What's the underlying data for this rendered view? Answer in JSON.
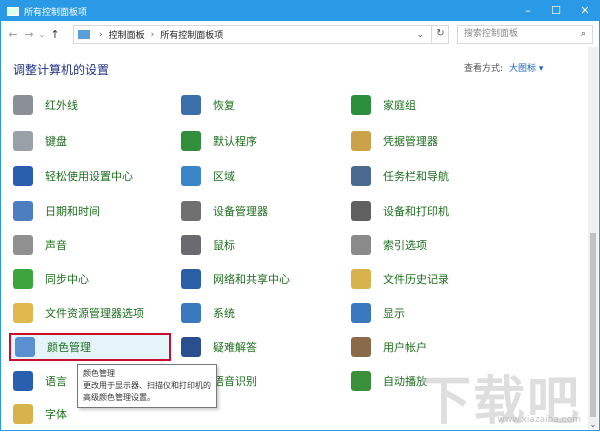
{
  "window": {
    "title": "所有控制面板项",
    "min": "–",
    "max": "☐",
    "close": "✕"
  },
  "address": {
    "back": "←",
    "forward": "→",
    "recent": "⌄",
    "up": "↑",
    "crumbs": [
      "控制面板",
      "所有控制面板项"
    ],
    "sep": "›",
    "dropdown": "⌄",
    "refresh": "↻",
    "search_placeholder": "搜索控制面板",
    "search_icon": "⌕"
  },
  "heading": "调整计算机的设置",
  "view": {
    "label": "查看方式:",
    "value": "大图标 ▾"
  },
  "items": [
    {
      "label": "红外线",
      "icon": "infrared-icon",
      "color": "#8a8f98"
    },
    {
      "label": "恢复",
      "icon": "recovery-icon",
      "color": "#3a6fa8"
    },
    {
      "label": "家庭组",
      "icon": "homegroup-icon",
      "color": "#2c8f3c"
    },
    {
      "label": "键盘",
      "icon": "keyboard-icon",
      "color": "#9aa0a8"
    },
    {
      "label": "默认程序",
      "icon": "default-programs-icon",
      "color": "#2f8f3a"
    },
    {
      "label": "凭据管理器",
      "icon": "credential-manager-icon",
      "color": "#c9a24a"
    },
    {
      "label": "轻松使用设置中心",
      "icon": "ease-of-access-icon",
      "color": "#2a5fb0"
    },
    {
      "label": "区域",
      "icon": "region-icon",
      "color": "#3b86c8"
    },
    {
      "label": "任务栏和导航",
      "icon": "taskbar-icon",
      "color": "#4a6a90"
    },
    {
      "label": "日期和时间",
      "icon": "date-time-icon",
      "color": "#4d7fc0"
    },
    {
      "label": "设备管理器",
      "icon": "device-manager-icon",
      "color": "#707070"
    },
    {
      "label": "设备和打印机",
      "icon": "devices-printers-icon",
      "color": "#606060"
    },
    {
      "label": "声音",
      "icon": "sound-icon",
      "color": "#909090"
    },
    {
      "label": "鼠标",
      "icon": "mouse-icon",
      "color": "#6a6a70"
    },
    {
      "label": "索引选项",
      "icon": "indexing-icon",
      "color": "#8a8a8a"
    },
    {
      "label": "同步中心",
      "icon": "sync-center-icon",
      "color": "#3da53d"
    },
    {
      "label": "网络和共享中心",
      "icon": "network-icon",
      "color": "#2a5fa8"
    },
    {
      "label": "文件历史记录",
      "icon": "file-history-icon",
      "color": "#d8b24a"
    },
    {
      "label": "文件资源管理器选项",
      "icon": "folder-options-icon",
      "color": "#e0b94e"
    },
    {
      "label": "系统",
      "icon": "system-icon",
      "color": "#3a78c0"
    },
    {
      "label": "显示",
      "icon": "display-icon",
      "color": "#3a78c0"
    },
    {
      "label": "颜色管理",
      "icon": "color-management-icon",
      "color": "#5a8fd0"
    },
    {
      "label": "疑难解答",
      "icon": "troubleshooting-icon",
      "color": "#2a4f90"
    },
    {
      "label": "用户帐户",
      "icon": "user-accounts-icon",
      "color": "#8a6a4a"
    },
    {
      "label": "语言",
      "icon": "language-icon",
      "color": "#2a5fb0"
    },
    {
      "label": "语音识别",
      "icon": "speech-recognition-icon",
      "color": "#707070"
    },
    {
      "label": "自动播放",
      "icon": "autoplay-icon",
      "color": "#3a8f3a"
    },
    {
      "label": "字体",
      "icon": "fonts-icon",
      "color": "#d8b24a"
    }
  ],
  "tooltip": {
    "title": "颜色管理",
    "line1": "更改用于显示器、扫描仪和打印机的",
    "line2": "高级颜色管理设置。"
  },
  "watermark": {
    "text": "下载吧",
    "url": "www.xiazaiba.com"
  }
}
